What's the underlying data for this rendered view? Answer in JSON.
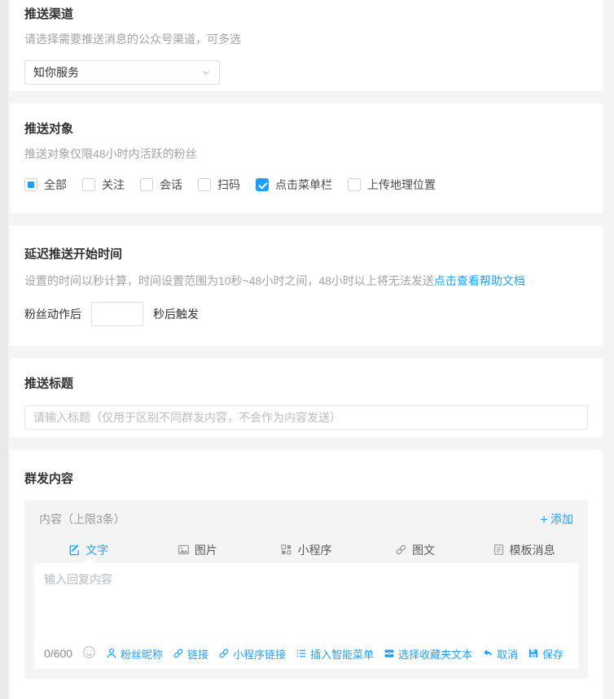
{
  "colors": {
    "accent": "#1E9FFF"
  },
  "channel": {
    "title": "推送渠道",
    "desc": "请选择需要推送消息的公众号渠道，可多选",
    "selected": "知你服务"
  },
  "target": {
    "title": "推送对象",
    "desc": "推送对象仅限48小时内活跃的粉丝",
    "options": [
      {
        "label": "全部",
        "state": "indeterminate"
      },
      {
        "label": "关注",
        "state": "unchecked"
      },
      {
        "label": "会话",
        "state": "unchecked"
      },
      {
        "label": "扫码",
        "state": "unchecked"
      },
      {
        "label": "点击菜单栏",
        "state": "checked"
      },
      {
        "label": "上传地理位置",
        "state": "unchecked"
      }
    ]
  },
  "delay": {
    "title": "延迟推送开始时间",
    "desc": "设置的时间以秒计算，时间设置范围为10秒~48小时之间，48小时以上将无法发送",
    "link": "点击查看帮助文档",
    "prefix": "粉丝动作后",
    "suffix": "秒后触发",
    "value": ""
  },
  "push_title": {
    "title": "推送标题",
    "placeholder": "请输入标题（仅用于区别不同群发内容，不会作为内容发送）"
  },
  "content": {
    "title": "群发内容",
    "panel_title": "内容（上限3条）",
    "add_plus": "+",
    "add_label": "添加",
    "tabs": [
      {
        "label": "文字",
        "active": true
      },
      {
        "label": "图片",
        "active": false
      },
      {
        "label": "小程序",
        "active": false
      },
      {
        "label": "图文",
        "active": false
      },
      {
        "label": "模板消息",
        "active": false
      }
    ],
    "placeholder": "输入回复内容",
    "counter": "0/600",
    "tools": [
      {
        "label": "粉丝昵称"
      },
      {
        "label": "链接"
      },
      {
        "label": "小程序链接"
      },
      {
        "label": "插入智能菜单"
      },
      {
        "label": "选择收藏夹文本"
      },
      {
        "label": "取消"
      },
      {
        "label": "保存"
      }
    ]
  }
}
